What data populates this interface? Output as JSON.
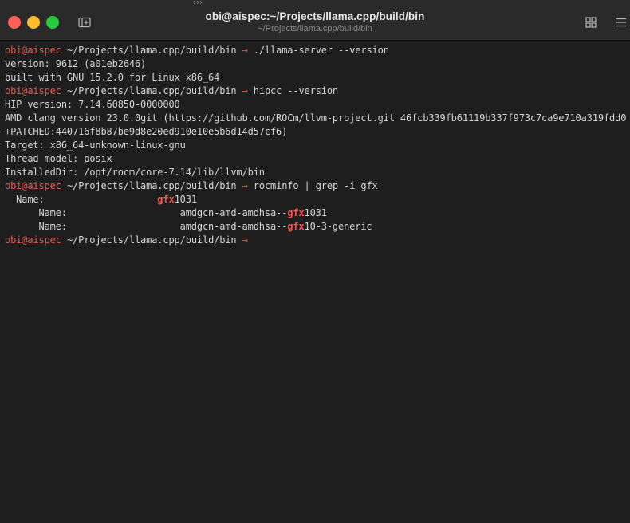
{
  "window": {
    "title": "obi@aispec:~/Projects/llama.cpp/build/bin",
    "subtitle": "~/Projects/llama.cpp/build/bin"
  },
  "colors": {
    "close": "#ff5f57",
    "minimize": "#febc2e",
    "zoom": "#28c840",
    "prompt_user": "#e05a4f",
    "match_highlight": "#ff4f4f"
  },
  "icons": {
    "new_tab": "new-tab-icon",
    "grid": "grid-icon",
    "menu": "menu-icon",
    "grip": "drag-grip-icon"
  },
  "terminal": {
    "prompt": {
      "user": "obi@aispec",
      "path": "~/Projects/llama.cpp/build/bin",
      "arrow": "→"
    },
    "lines": [
      {
        "type": "prompt",
        "command": "./llama-server --version"
      },
      {
        "type": "output",
        "text": "version: 9612 (a01eb2646)"
      },
      {
        "type": "output",
        "text": "built with GNU 15.2.0 for Linux x86_64"
      },
      {
        "type": "prompt",
        "command": "hipcc --version"
      },
      {
        "type": "output",
        "text": "HIP version: 7.14.60850-0000000"
      },
      {
        "type": "output",
        "text": "AMD clang version 23.0.0git (https://github.com/ROCm/llvm-project.git 46fcb339fb61119b337f973c7ca9e710a319fdd0"
      },
      {
        "type": "output",
        "text": "+PATCHED:440716f8b87be9d8e20ed910e10e5b6d14d57cf6)"
      },
      {
        "type": "output",
        "text": "Target: x86_64-unknown-linux-gnu"
      },
      {
        "type": "output",
        "text": "Thread model: posix"
      },
      {
        "type": "output",
        "text": "InstalledDir: /opt/rocm/core-7.14/lib/llvm/bin"
      },
      {
        "type": "prompt",
        "command": "rocminfo | grep -i gfx"
      },
      {
        "type": "match",
        "before": "  Name:                    ",
        "match": "gfx",
        "after": "1031"
      },
      {
        "type": "match",
        "before": "      Name:                    amdgcn-amd-amdhsa--",
        "match": "gfx",
        "after": "1031"
      },
      {
        "type": "match",
        "before": "      Name:                    amdgcn-amd-amdhsa--",
        "match": "gfx",
        "after": "10-3-generic"
      },
      {
        "type": "prompt",
        "command": ""
      }
    ]
  }
}
